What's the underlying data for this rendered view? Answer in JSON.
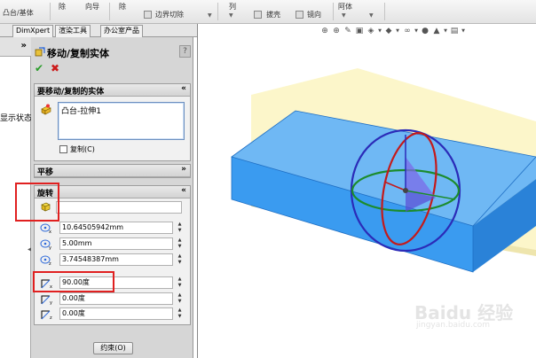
{
  "toolbar": {
    "feature_label": "凸台/基体",
    "remove1": "除",
    "wizard_label": "向导",
    "remove2": "除",
    "boundary_cut_label": "边界切除",
    "array_label": "列",
    "draft_label": "拔壳",
    "mirror_label": "镜向",
    "curves_label": "阿体"
  },
  "tabs": [
    "DimXpert",
    "渲染工具",
    "办公室产品"
  ],
  "tree": {
    "chevron": "»",
    "truncated_label": "显示状态"
  },
  "pm": {
    "title": "移动/复制实体",
    "help": "?",
    "ok_symbol": "✔",
    "cancel_symbol": "✖",
    "bodies_group": {
      "title": "要移动/复制的实体",
      "toggle": "«",
      "selected_body": "凸台-拉伸1",
      "copy_label": "复制(C)"
    },
    "translate_group": {
      "title": "平移",
      "toggle": "»"
    },
    "rotate_group": {
      "title": "旋转",
      "toggle": "«",
      "center_value": "",
      "x_coord": "10.64505942mm",
      "y_coord": "5.00mm",
      "z_coord": "3.74548387mm",
      "x_angle": "90.00度",
      "y_angle": "0.00度",
      "z_angle": "0.00度"
    },
    "constraint_button": "约束(O)"
  },
  "viewport": {
    "watermark": "Baidu 经验",
    "watermark_url": "jingyan.baidu.com"
  },
  "colors": {
    "accent_red": "#e02020",
    "ok_green": "#2a9d2a",
    "body_blue": "#3a9bf0",
    "body_translucent_yellow": "#fff3b0"
  }
}
